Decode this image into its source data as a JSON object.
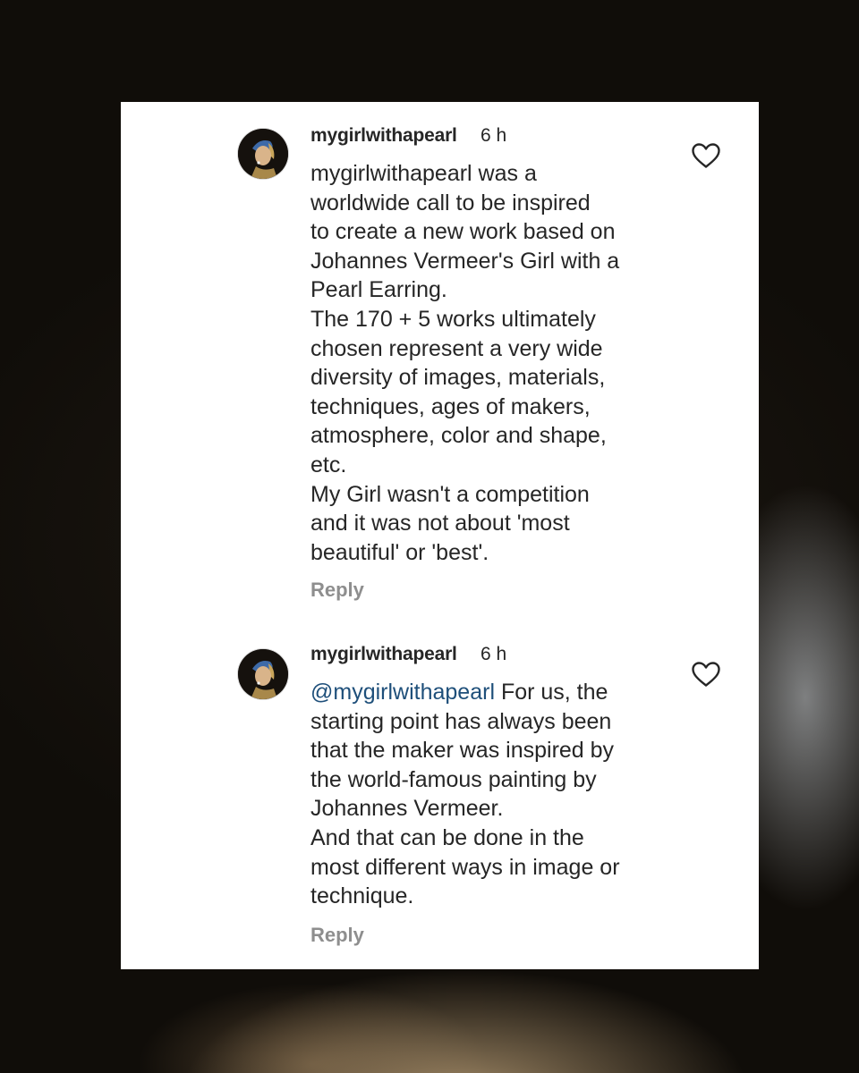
{
  "colors": {
    "card_background": "#ffffff",
    "text": "#262626",
    "mention": "#1e4f7a",
    "reply": "#8e8e8e",
    "page_background": "#120f0b"
  },
  "comments": [
    {
      "username": "mygirlwithapearl",
      "time": "6 h",
      "avatar_icon": "girl-with-pearl-earring-avatar",
      "lines": [
        "mygirlwithapearl was a",
        "worldwide call to be inspired",
        "to create a new work based on",
        "Johannes Vermeer's Girl with a",
        "Pearl Earring.",
        "The 170 + 5 works ultimately",
        "chosen represent a very wide",
        "diversity of images, materials,",
        "techniques, ages of makers,",
        "atmosphere, color and shape,",
        "etc.",
        "My Girl wasn't a competition",
        "and it was not about 'most",
        "beautiful' or 'best'."
      ],
      "reply_label": "Reply",
      "like_icon": "heart-outline-icon"
    },
    {
      "username": "mygirlwithapearl",
      "time": "6 h",
      "avatar_icon": "girl-with-pearl-earring-avatar",
      "mention": "@mygirlwithapearl",
      "first_line_rest": " For us, the",
      "lines": [
        "starting point has always been",
        "that the maker was inspired by",
        "the world-famous painting by",
        "Johannes Vermeer.",
        "And that can be done in the",
        "most different ways in image or",
        "technique."
      ],
      "reply_label": "Reply",
      "like_icon": "heart-outline-icon"
    }
  ]
}
